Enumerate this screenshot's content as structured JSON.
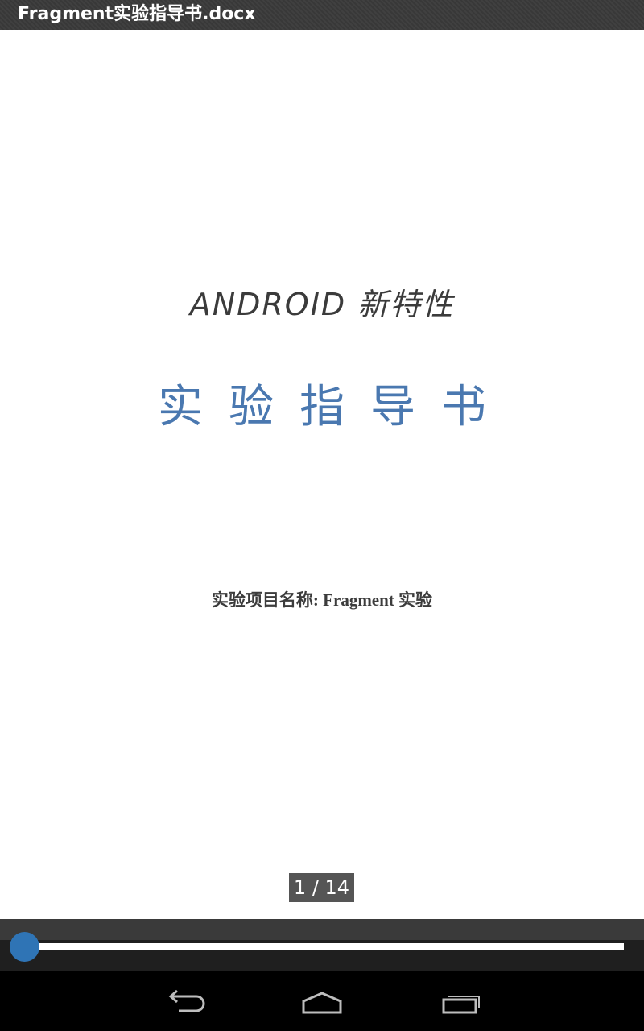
{
  "window": {
    "title": "Fragment实验指导书.docx"
  },
  "document": {
    "subtitle": "ANDROID  新特性",
    "title": "实验指导书",
    "project_line": "实验项目名称: Fragment 实验"
  },
  "pager": {
    "indicator": "1 / 14",
    "current_page": 1,
    "total_pages": 14
  },
  "seekbar": {
    "position_fraction": 0.0
  },
  "navbar": {
    "back_icon": "back-arrow",
    "home_icon": "home-outline",
    "recents_icon": "recent-apps"
  },
  "colors": {
    "title_blue": "#4a78b0",
    "seek_accent": "#2f74b5"
  }
}
